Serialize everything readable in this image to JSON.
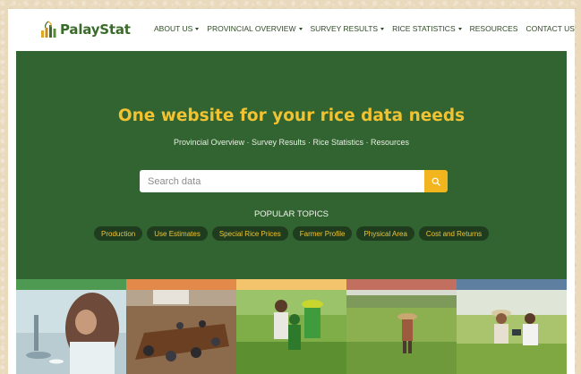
{
  "brand": {
    "name": "PalayStat",
    "logo_icon": "rice-plant-bar-chart-icon"
  },
  "nav": {
    "items": [
      {
        "label": "ABOUT US",
        "dropdown": true
      },
      {
        "label": "PROVINCIAL OVERVIEW",
        "dropdown": true
      },
      {
        "label": "SURVEY RESULTS",
        "dropdown": true
      },
      {
        "label": "RICE STATISTICS",
        "dropdown": true
      },
      {
        "label": "RESOURCES",
        "dropdown": false
      },
      {
        "label": "CONTACT US",
        "dropdown": false
      }
    ]
  },
  "hero": {
    "title": "One website for your rice data needs",
    "subtitle": "Provincial Overview · Survey Results · Rice Statistics · Resources",
    "search": {
      "placeholder": "Search data",
      "icon": "search-icon"
    },
    "popular_title": "POPULAR TOPICS",
    "topics": [
      "Production",
      "Use Estimates",
      "Special Rice Prices",
      "Farmer Profile",
      "Physical Area",
      "Cost and Returns"
    ]
  },
  "colors": {
    "hero_bg": "#316430",
    "accent_yellow": "#f1c232",
    "search_button": "#f2b51e",
    "photo_stripes": [
      "#4f9a52",
      "#e3894a",
      "#f4c46c",
      "#c36f5f",
      "#5f7fa0"
    ]
  }
}
